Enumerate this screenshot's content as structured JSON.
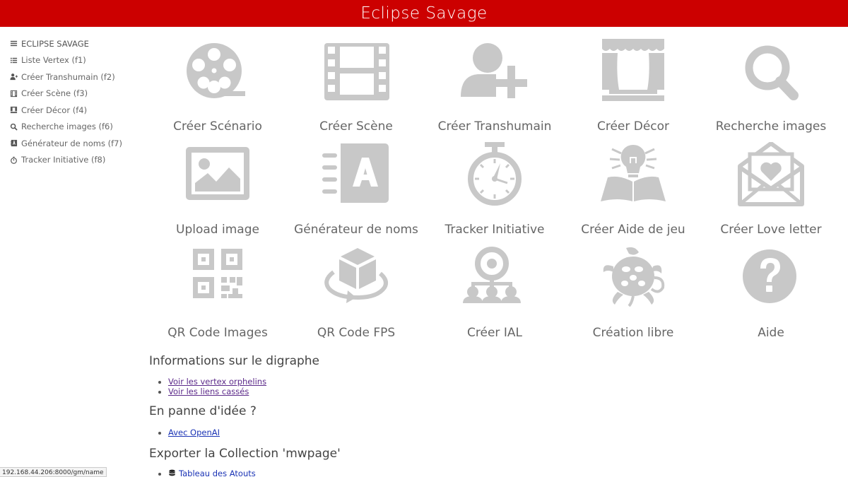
{
  "app_title": "Eclipse Savage",
  "sidebar": {
    "items": [
      {
        "label": "ECLIPSE SAVAGE",
        "icon": "menu-icon"
      },
      {
        "label": "Liste Vertex (f1)",
        "icon": "list-icon"
      },
      {
        "label": "Créer Transhumain (f2)",
        "icon": "user-plus-icon"
      },
      {
        "label": "Créer Scène (f3)",
        "icon": "film-icon"
      },
      {
        "label": "Créer Décor (f4)",
        "icon": "theater-icon"
      },
      {
        "label": "Recherche images (f6)",
        "icon": "search-icon"
      },
      {
        "label": "Générateur de noms (f7)",
        "icon": "address-book-icon"
      },
      {
        "label": "Tracker Initiative (f8)",
        "icon": "stopwatch-icon"
      }
    ]
  },
  "tiles": [
    {
      "label": "Créer Scénario",
      "icon": "film-reel-icon"
    },
    {
      "label": "Créer Scène",
      "icon": "film-strip-icon"
    },
    {
      "label": "Créer Transhumain",
      "icon": "user-plus-icon"
    },
    {
      "label": "Créer Décor",
      "icon": "theater-curtain-icon"
    },
    {
      "label": "Recherche images",
      "icon": "search-icon"
    },
    {
      "label": "Upload image",
      "icon": "image-icon"
    },
    {
      "label": "Générateur de noms",
      "icon": "address-book-icon"
    },
    {
      "label": "Tracker Initiative",
      "icon": "stopwatch-icon"
    },
    {
      "label": "Créer Aide de jeu",
      "icon": "idea-book-icon"
    },
    {
      "label": "Créer Love letter",
      "icon": "love-letter-icon"
    },
    {
      "label": "QR Code Images",
      "icon": "qr-code-icon"
    },
    {
      "label": "QR Code FPS",
      "icon": "cube-rotate-icon"
    },
    {
      "label": "Créer IAL",
      "icon": "network-icon"
    },
    {
      "label": "Création libre",
      "icon": "turtle-icon"
    },
    {
      "label": "Aide",
      "icon": "question-circle-icon"
    }
  ],
  "sections": {
    "digraph": {
      "title": "Informations sur le digraphe",
      "links": [
        "Voir les vertex orphelins",
        "Voir les liens cassés"
      ]
    },
    "ideas": {
      "title": "En panne d'idée ?",
      "links": [
        "Avec OpenAI"
      ]
    },
    "export": {
      "title": "Exporter la Collection 'mwpage'",
      "links": [
        "Tableau des Atouts"
      ]
    }
  },
  "status_url": "192.168.44.206:8000/gm/name",
  "colors": {
    "header": "#cc0000",
    "icon_gray": "#c8c8c8"
  }
}
